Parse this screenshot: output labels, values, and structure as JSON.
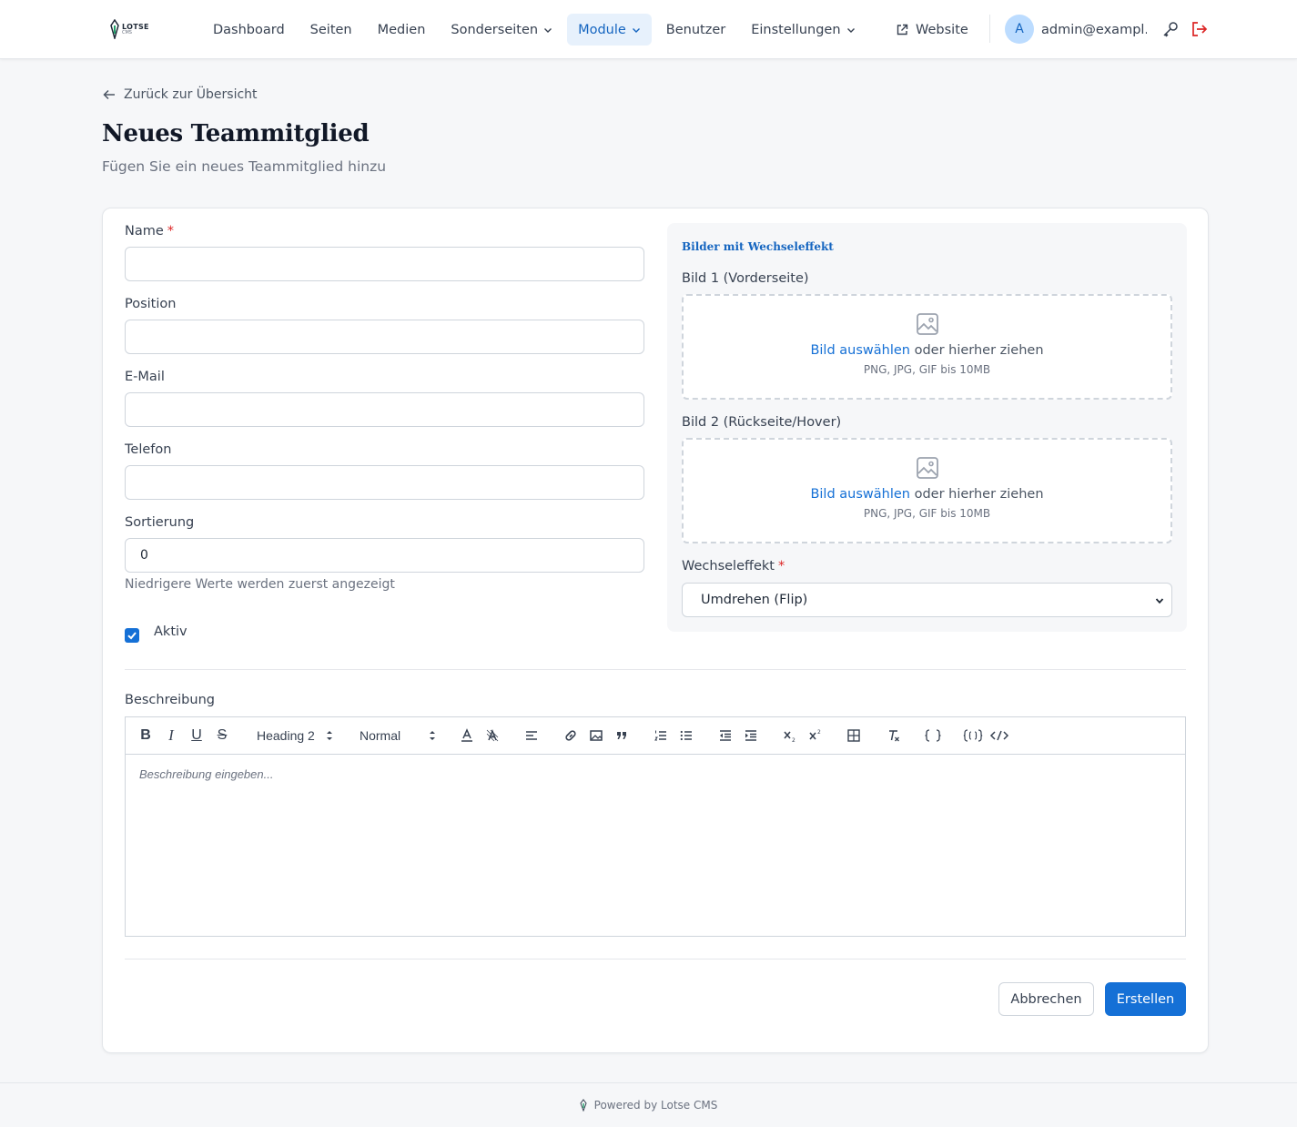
{
  "header": {
    "logo": {
      "line1": "LOTSE",
      "line2": "CMS"
    },
    "nav": [
      {
        "label": "Dashboard",
        "dropdown": false
      },
      {
        "label": "Seiten",
        "dropdown": false
      },
      {
        "label": "Medien",
        "dropdown": false
      },
      {
        "label": "Sonderseiten",
        "dropdown": true
      },
      {
        "label": "Module",
        "dropdown": true,
        "active": true
      },
      {
        "label": "Benutzer",
        "dropdown": false
      },
      {
        "label": "Einstellungen",
        "dropdown": true
      }
    ],
    "website_label": "Website",
    "avatar_initial": "A",
    "user_email": "admin@exampl..."
  },
  "page": {
    "back_label": "Zurück zur Übersicht",
    "title": "Neues Teammitglied",
    "subtitle": "Fügen Sie ein neues Teammitglied hinzu"
  },
  "form": {
    "required_mark": "*",
    "name": {
      "label": "Name",
      "value": ""
    },
    "position": {
      "label": "Position",
      "value": ""
    },
    "email": {
      "label": "E-Mail",
      "value": ""
    },
    "phone": {
      "label": "Telefon",
      "value": ""
    },
    "sort": {
      "label": "Sortierung",
      "value": "0",
      "hint": "Niedrigere Werte werden zuerst angezeigt"
    },
    "active": {
      "label": "Aktiv",
      "checked": true
    },
    "images": {
      "title": "Bilder mit Wechseleffekt",
      "image1_label": "Bild 1 (Vorderseite)",
      "image2_label": "Bild 2 (Rückseite/Hover)",
      "drop_link": "Bild auswählen",
      "drop_text": " oder hierher ziehen",
      "drop_hint": "PNG, JPG, GIF bis 10MB",
      "effect_label": "Wechseleffekt",
      "effect_value": "Umdrehen (Flip)"
    },
    "description": {
      "label": "Beschreibung",
      "heading_select": "Heading 2",
      "size_select": "Normal",
      "placeholder": "Beschreibung eingeben..."
    },
    "cancel_label": "Abbrechen",
    "submit_label": "Erstellen"
  },
  "footer": {
    "text": "Powered by Lotse CMS"
  },
  "colors": {
    "accent": "#1570d6",
    "danger": "#dc2626",
    "nav_active_bg": "#e7f1fc"
  }
}
